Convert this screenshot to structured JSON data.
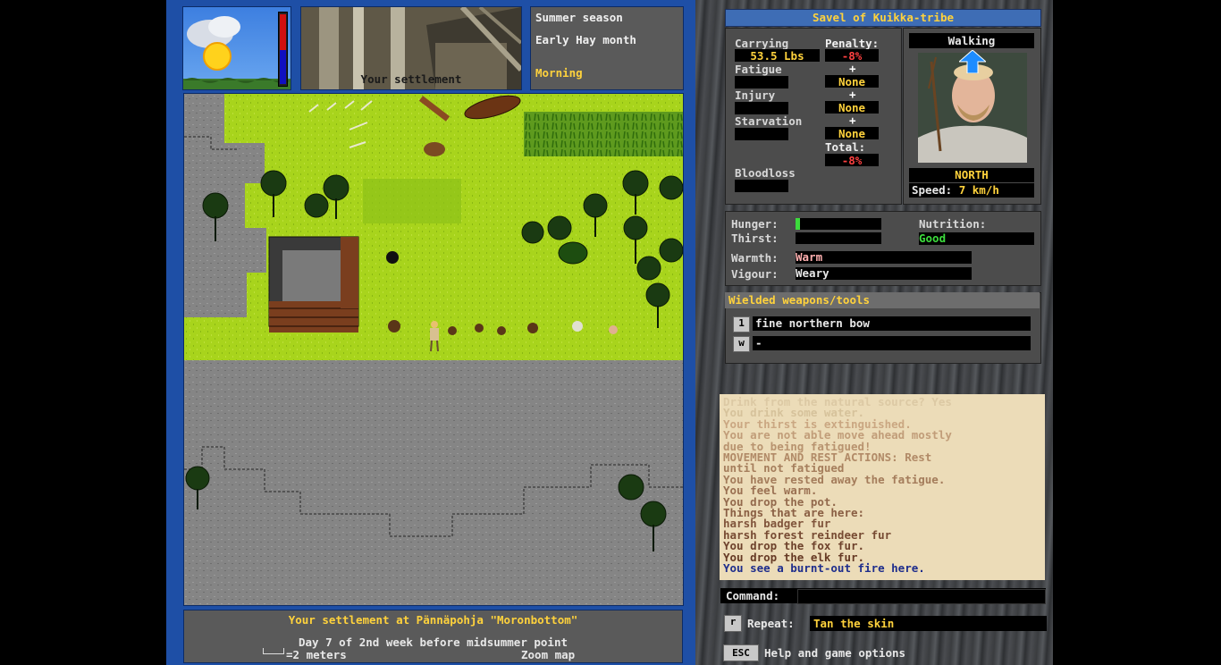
{
  "top": {
    "settlement_caption": "Your settlement",
    "season": "Summer season",
    "month": "Early Hay month",
    "time_of_day": "Morning"
  },
  "character": {
    "title": "Savel of Kuikka-tribe",
    "carrying_label": "Carrying",
    "carrying_value": "53.5 Lbs",
    "penalty_label": "Penalty:",
    "penalty_carrying": "-8%",
    "fatigue_label": "Fatigue",
    "plus1": "+",
    "penalty_fatigue": "None",
    "injury_label": "Injury",
    "plus2": "+",
    "penalty_injury": "None",
    "starvation_label": "Starvation",
    "plus3": "+",
    "penalty_starvation": "None",
    "total_label": "Total:",
    "penalty_total": "-8%",
    "bloodloss_label": "Bloodloss",
    "mode": "Walking",
    "direction": "NORTH",
    "speed_label": "Speed:",
    "speed_value": "7 km/h"
  },
  "condition": {
    "hunger_label": "Hunger:",
    "hunger_level": 0.05,
    "thirst_label": "Thirst:",
    "nutrition_label": "Nutrition:",
    "nutrition_value": "Good",
    "warmth_label": "Warmth:",
    "warmth_value": "Warm",
    "vigour_label": "Vigour:",
    "vigour_value": "Weary"
  },
  "weapons": {
    "title": "Wielded weapons/tools",
    "slot1_key": "1",
    "slot1_value": "fine northern bow",
    "slot2_key": "w",
    "slot2_value": "-"
  },
  "log": [
    {
      "text": "Drink from the natural source? Yes",
      "color": "#dcc9a4"
    },
    {
      "text": "You drink some water.",
      "color": "#d6c29b"
    },
    {
      "text": "Your thirst is extinguished.",
      "color": "#caa782"
    },
    {
      "text": "You are not able move ahead mostly",
      "color": "#c19d79"
    },
    {
      "text": "due to being fatigued!",
      "color": "#b8936f"
    },
    {
      "text": "MOVEMENT AND REST ACTIONS: Rest",
      "color": "#b18a67"
    },
    {
      "text": "until not fatigued",
      "color": "#a57e5c"
    },
    {
      "text": "You have rested away the fatigue.",
      "color": "#a47c5b"
    },
    {
      "text": "You feel warm.",
      "color": "#9a7052"
    },
    {
      "text": "You drop the pot.",
      "color": "#936a4d"
    },
    {
      "text": "Things that are here:",
      "color": "#8a5f44"
    },
    {
      "text": "harsh badger fur",
      "color": "#80543b"
    },
    {
      "text": "harsh forest reindeer fur",
      "color": "#774b33"
    },
    {
      "text": "You drop the fox fur.",
      "color": "#6e422c"
    },
    {
      "text": "You drop the elk fur.",
      "color": "#663a25"
    },
    {
      "text": "You see a burnt-out fire here.",
      "color": "#1e2d8c"
    }
  ],
  "command": {
    "label": "Command:",
    "value": "",
    "repeat_key": "r",
    "repeat_label": "Repeat:",
    "repeat_value": "Tan the skin",
    "esc_key": "ESC",
    "esc_label": "Help and game options"
  },
  "map_footer": {
    "location": "Your settlement at Pännäpohja \"Moronbottom\"",
    "date": "Day 7 of 2nd week before midsummer point",
    "scale": "=2 meters",
    "zoom": "Zoom map"
  },
  "colors": {
    "accent_yellow": "#ffd23c",
    "penalty_red": "#ff4040",
    "nutrition_green": "#3cdc3c",
    "warmth_pink": "#ffb0b0",
    "grass": "#a8d41c"
  }
}
